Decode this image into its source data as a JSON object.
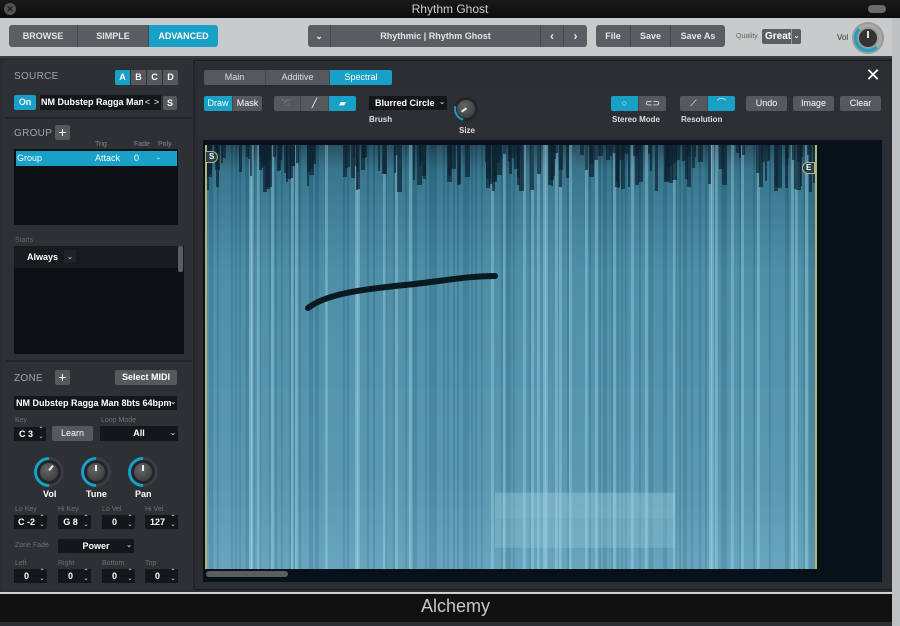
{
  "window": {
    "title": "Rhythm Ghost",
    "brand": "Alchemy"
  },
  "topbar": {
    "modes": [
      {
        "label": "BROWSE",
        "active": false
      },
      {
        "label": "SIMPLE",
        "active": false
      },
      {
        "label": "ADVANCED",
        "active": true
      }
    ],
    "preset_name": "Rhythmic | Rhythm Ghost",
    "file_label": "File",
    "save_label": "Save",
    "save_as_label": "Save As",
    "quality_label": "Quality",
    "quality_value": "Great",
    "vol_label": "Vol"
  },
  "source": {
    "label": "SOURCE",
    "slots": [
      "A",
      "B",
      "C",
      "D"
    ],
    "active_slot": "A",
    "on_label": "On",
    "name": "NM Dubstep Ragga Man",
    "prev": "<",
    "next": ">",
    "s_label": "S"
  },
  "group": {
    "label": "GROUP",
    "headers": {
      "trig": "Trig",
      "fade": "Fade",
      "poly": "Poly"
    },
    "rows": [
      {
        "name": "Group",
        "trig": "Attack",
        "fade": "0",
        "poly": "-"
      }
    ],
    "starts_label": "Starts",
    "starts_value": "Always"
  },
  "zone": {
    "label": "ZONE",
    "select_midi": "Select MIDI",
    "sample": "NM Dubstep Ragga Man 8bts 64bpm",
    "key_label": "Key",
    "key_value": "C 3",
    "learn_label": "Learn",
    "loop_mode_label": "Loop Mode",
    "loop_mode_value": "All",
    "knobs": [
      {
        "label": "Vol"
      },
      {
        "label": "Tune"
      },
      {
        "label": "Pan"
      }
    ],
    "ranges": [
      {
        "label": "Lo Key",
        "value": "C -2"
      },
      {
        "label": "Hi Key",
        "value": "G 8"
      },
      {
        "label": "Lo Vel",
        "value": "0"
      },
      {
        "label": "Hi Vel",
        "value": "127"
      }
    ],
    "zone_fade_label": "Zone Fade",
    "zone_fade_value": "Power",
    "fades": [
      {
        "label": "Left",
        "value": "0"
      },
      {
        "label": "Right",
        "value": "0"
      },
      {
        "label": "Bottom",
        "value": "0"
      },
      {
        "label": "Top",
        "value": "0"
      }
    ]
  },
  "editor": {
    "tabs": [
      {
        "label": "Main",
        "active": false
      },
      {
        "label": "Additive",
        "active": false
      },
      {
        "label": "Spectral",
        "active": true
      }
    ],
    "draw_label": "Draw",
    "mask_label": "Mask",
    "tools": [
      "lasso-icon",
      "pencil-icon",
      "eraser-icon"
    ],
    "active_tool": "eraser-icon",
    "brush_value": "Blurred Circle",
    "brush_label": "Brush",
    "size_label": "Size",
    "stereo_mode_label": "Stereo Mode",
    "resolution_label": "Resolution",
    "undo_label": "Undo",
    "image_label": "Image",
    "clear_label": "Clear",
    "start_marker": "S",
    "end_marker": "E"
  }
}
